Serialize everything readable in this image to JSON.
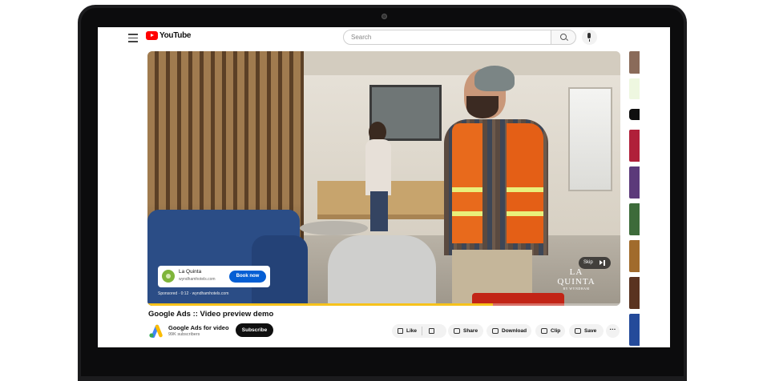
{
  "header": {
    "logo_text": "YouTube",
    "search_placeholder": "Search"
  },
  "ad": {
    "advertiser": "La Quinta",
    "url": "wyndhamhotels.com",
    "cta": "Book now",
    "sponsored_line": "Sponsored · 0:12 · wyndhamhotels.com",
    "skip_label": "Skip",
    "watermark": "LA QUINTA",
    "watermark_sub": "BY WYNDHAM",
    "progress": 0.73
  },
  "video": {
    "title": "Google Ads :: Video preview demo"
  },
  "channel": {
    "name": "Google Ads for video",
    "subscribers": "99K subscribers",
    "subscribe_label": "Subscribe"
  },
  "actions": {
    "like": "Like",
    "share": "Share",
    "download": "Download",
    "clip": "Clip",
    "save": "Save",
    "more": "···"
  },
  "colors": {
    "youtube_red": "#ff0000",
    "cta_blue": "#065fd4",
    "progress_yellow": "#f6c21b",
    "vest_orange": "#e86a1c"
  }
}
